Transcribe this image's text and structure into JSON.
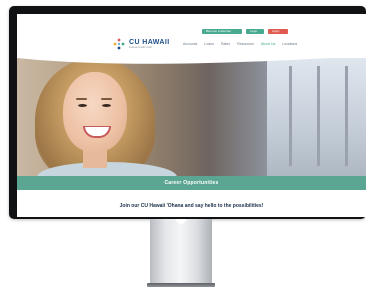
{
  "header": {
    "top_buttons": [
      {
        "label": "Become a Member",
        "style": "green"
      },
      {
        "label": "Login",
        "style": "green"
      },
      {
        "label": "Apply",
        "style": "red"
      }
    ],
    "logo": {
      "name": "CU HAWAII",
      "tagline": "Federal Credit Union"
    },
    "nav": [
      {
        "label": "Accounts",
        "active": false
      },
      {
        "label": "Loans",
        "active": false
      },
      {
        "label": "Rates",
        "active": false
      },
      {
        "label": "Resources",
        "active": false
      },
      {
        "label": "About Us",
        "active": true
      },
      {
        "label": "Locations",
        "active": false
      }
    ]
  },
  "hero": {
    "banner_title": "Career Opportunities"
  },
  "tagline": "Join our CU Hawaii 'Ohana and say hello to the possibilities!",
  "colors": {
    "accent_green": "#47a98f",
    "band_green": "#5aa692",
    "apply_red": "#e05a4f",
    "brand_blue": "#1c4e8a"
  }
}
